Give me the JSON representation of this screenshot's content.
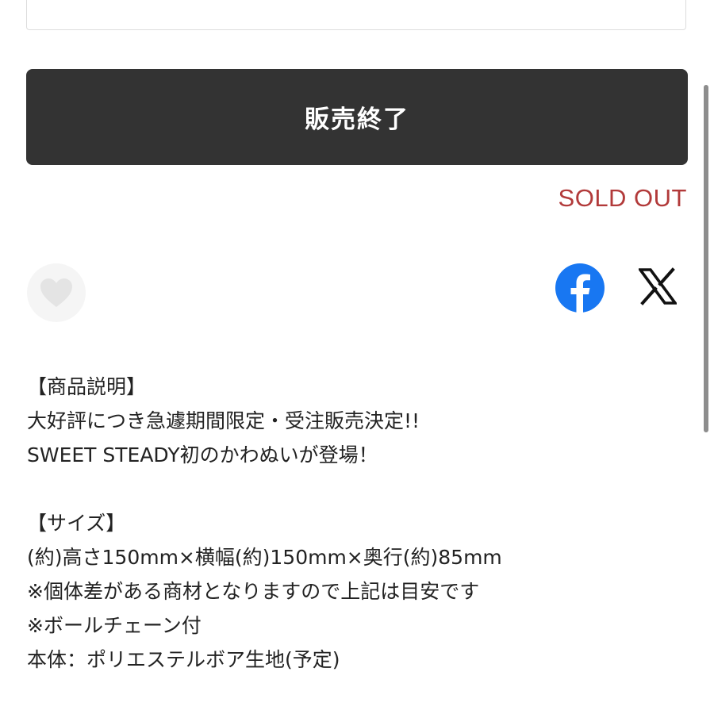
{
  "product": {
    "button_label": "販売終了",
    "status_label": "SOLD OUT"
  },
  "icons": {
    "favorite": "heart-icon",
    "facebook": "facebook-icon",
    "x": "x-icon"
  },
  "colors": {
    "button_bg": "#333333",
    "sold_out_text": "#b23a3a",
    "facebook_blue": "#1877f2"
  },
  "description": {
    "lines": [
      "【商品説明】",
      "大好評につき急遽期間限定・受注販売決定!!",
      "SWEET STEADY初のかわぬいが登場！",
      "",
      "【サイズ】",
      "(約)高さ150mm×横幅(約)150mm×奥行(約)85mm",
      "※個体差がある商材となりますので上記は目安です",
      "※ボールチェーン付",
      "本体：ポリエステルボア生地(予定)"
    ]
  }
}
